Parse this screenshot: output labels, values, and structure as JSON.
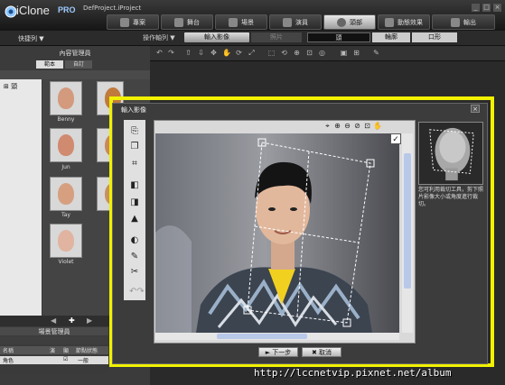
{
  "app": {
    "name": "iClone",
    "edition": "PRO",
    "project": "DefProject.iProject"
  },
  "window_buttons": [
    "_",
    "□",
    "×"
  ],
  "main_tabs": [
    {
      "label": "專案",
      "active": false
    },
    {
      "label": "舞台",
      "active": false
    },
    {
      "label": "場景",
      "active": false
    },
    {
      "label": "演員",
      "active": false
    },
    {
      "label": "頭部",
      "active": true
    },
    {
      "label": "動態效果",
      "active": false
    },
    {
      "label": "輸出",
      "active": false
    }
  ],
  "toolbar2": {
    "quick_key": "快捷列 ▼",
    "play_bar": "操作軸列 ▼",
    "sub_tabs": [
      "輸入影像",
      "照片",
      "頭",
      "輪廓",
      "口形"
    ]
  },
  "left_panel": {
    "title": "內容管理員",
    "tabs": [
      "範本",
      "自訂"
    ],
    "tree_item": "頭",
    "thumbnails": [
      {
        "label": "Benny",
        "skin": "#d39a7e"
      },
      {
        "label": "",
        "skin": "#c07a3c"
      },
      {
        "label": "Jun",
        "skin": "#d08a70"
      },
      {
        "label": "",
        "skin": "#c88a5c"
      },
      {
        "label": "Tay",
        "skin": "#d6a080"
      },
      {
        "label": "",
        "skin": "#c89060"
      },
      {
        "label": "Violet",
        "skin": "#e0b4a0"
      }
    ]
  },
  "scene_manager": {
    "title": "場景管理員",
    "headers": [
      "名稱",
      "演",
      "顯",
      "節點狀態"
    ],
    "rows": [
      {
        "name": "角色",
        "state": "一般"
      }
    ]
  },
  "dialog": {
    "title": "輸入影像",
    "close": "×",
    "check": "✓",
    "hint": "您可利用裁切工具，剪下照片影像大小或角度進行裁切。",
    "buttons": {
      "next": "► 下一步",
      "cancel": "✖ 取消"
    }
  },
  "watermark": "http://lccnetvip.pixnet.net/album",
  "colors": {
    "highlight_frame": "#f1f100",
    "active_tab": "#d0d0d0"
  }
}
